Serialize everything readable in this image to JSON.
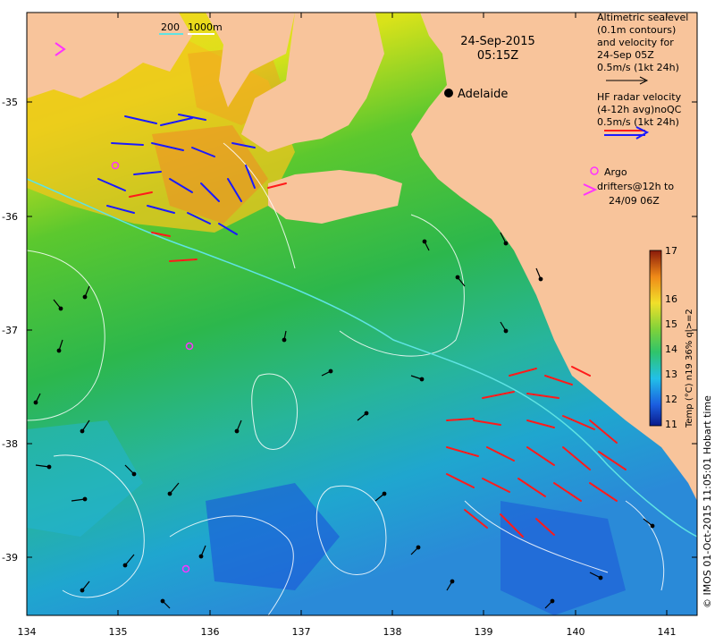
{
  "map": {
    "date": "24-Sep-2015",
    "time": "05:15Z",
    "city": "Adelaide",
    "depth_labels": {
      "shallow": "200",
      "deep": "1000m"
    },
    "lon_ticks": [
      "134",
      "135",
      "136",
      "137",
      "138",
      "139",
      "140",
      "141"
    ],
    "lat_ticks": [
      "-35",
      "-36",
      "-37",
      "-38",
      "-39"
    ],
    "colors": {
      "land": "#f8c49b",
      "sst_cold": "#1a3fc0",
      "sst_warm": "#e6a020",
      "model_arrow": "#000000",
      "radar_arrow_a": "#ff1a1a",
      "radar_arrow_b": "#1a1aff",
      "argo": "#ff33ff",
      "contour": "#ffffff",
      "isobath_200": "#5fe3e3"
    }
  },
  "legend": {
    "altimetry": {
      "line1": "Altimetric sealevel",
      "line2": "(0.1m contours)",
      "line3": "and velocity for",
      "line4": "24-Sep 05Z",
      "line5": "0.5m/s (1kt 24h)"
    },
    "radar": {
      "line1": "HF radar velocity",
      "line2": "(4-12h avg)noQC",
      "line3": "0.5m/s (1kt 24h)"
    },
    "argo": {
      "line1": "Argo",
      "line2": "drifters@12h to",
      "line3": "24/09 06Z"
    }
  },
  "colorbar": {
    "title": "Temp (°C) n19 36% ql>=2",
    "ticks": [
      "11",
      "12",
      "13",
      "14",
      "15",
      "16",
      "17"
    ]
  },
  "credit": "© IMOS 01-Oct-2015 11:05:01 Hobart time"
}
